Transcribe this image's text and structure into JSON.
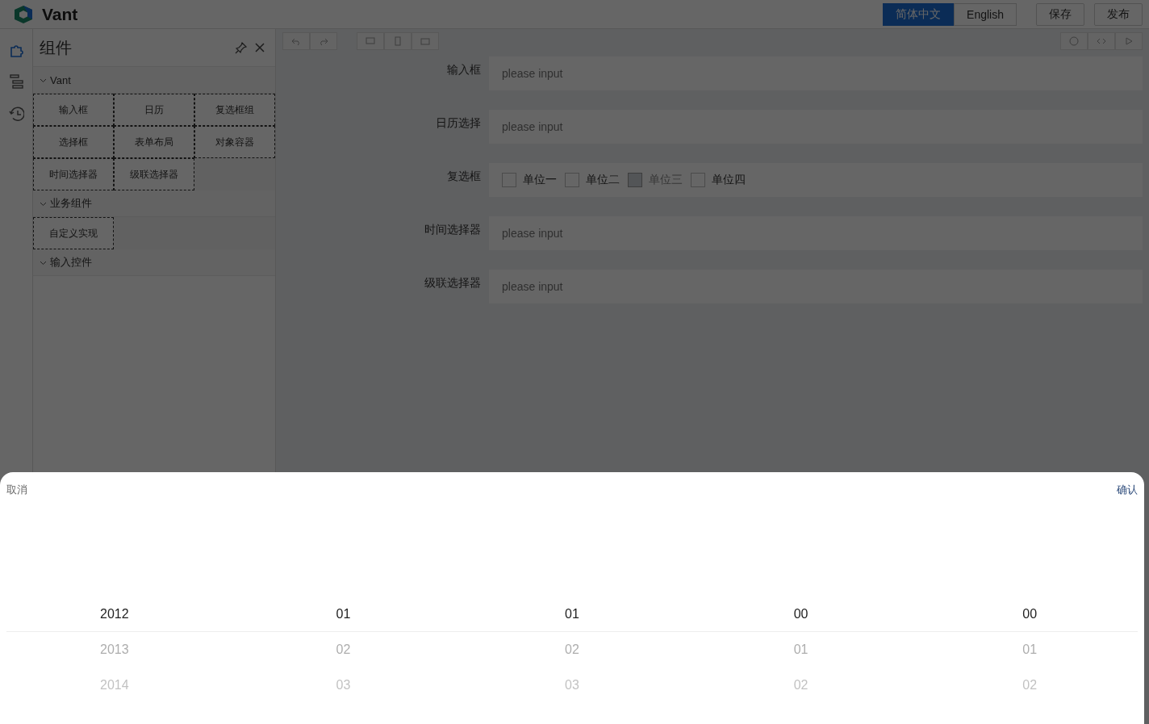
{
  "header": {
    "logo": "Vant",
    "languages": [
      {
        "label": "简体中文",
        "selected": true
      },
      {
        "label": "English",
        "selected": false
      }
    ],
    "actions": [
      "保存",
      "发布"
    ]
  },
  "side_tabs": [
    {
      "kind": "components",
      "selected": true
    },
    {
      "kind": "outline",
      "selected": false
    },
    {
      "kind": "history",
      "selected": false
    }
  ],
  "panel": {
    "title": "组件",
    "groups": [
      {
        "title": "Vant",
        "expanded": true,
        "items": [
          "输入框",
          "日历",
          "复选框组",
          "选择框",
          "表单布局",
          "对象容器",
          "时间选择器",
          "级联选择器"
        ]
      },
      {
        "title": "业务组件",
        "expanded": true,
        "items": [
          "自定义实现"
        ]
      },
      {
        "title": "输入控件",
        "expanded": true
      }
    ]
  },
  "form": {
    "fields": [
      {
        "kind": "input",
        "label": "输入框",
        "placeholder": "please input"
      },
      {
        "kind": "input",
        "label": "日历选择",
        "placeholder": "please input"
      },
      {
        "kind": "checkbox",
        "label": "复选框",
        "options": [
          {
            "label": "单位一",
            "checked": false,
            "disabled": false
          },
          {
            "label": "单位二",
            "checked": false,
            "disabled": false
          },
          {
            "label": "单位三",
            "checked": false,
            "disabled": true
          },
          {
            "label": "单位四",
            "checked": false,
            "disabled": false
          }
        ]
      },
      {
        "kind": "input",
        "label": "时间选择器",
        "placeholder": "please input"
      },
      {
        "kind": "input",
        "label": "级联选择器",
        "placeholder": "please input"
      }
    ]
  },
  "popup": {
    "cancel": "取消",
    "confirm": "确认",
    "columns": [
      {
        "options": [
          {
            "label": "2012",
            "selected": true
          },
          {
            "label": "2013",
            "selected": false
          },
          {
            "label": "2014",
            "selected": false
          }
        ]
      },
      {
        "options": [
          {
            "label": "01",
            "selected": true
          },
          {
            "label": "02",
            "selected": false
          },
          {
            "label": "03",
            "selected": false
          }
        ]
      },
      {
        "options": [
          {
            "label": "01",
            "selected": true
          },
          {
            "label": "02",
            "selected": false
          },
          {
            "label": "03",
            "selected": false
          }
        ]
      },
      {
        "options": [
          {
            "label": "00",
            "selected": true
          },
          {
            "label": "01",
            "selected": false
          },
          {
            "label": "02",
            "selected": false
          }
        ]
      },
      {
        "options": [
          {
            "label": "00",
            "selected": true
          },
          {
            "label": "01",
            "selected": false
          },
          {
            "label": "02",
            "selected": false
          }
        ]
      }
    ]
  }
}
